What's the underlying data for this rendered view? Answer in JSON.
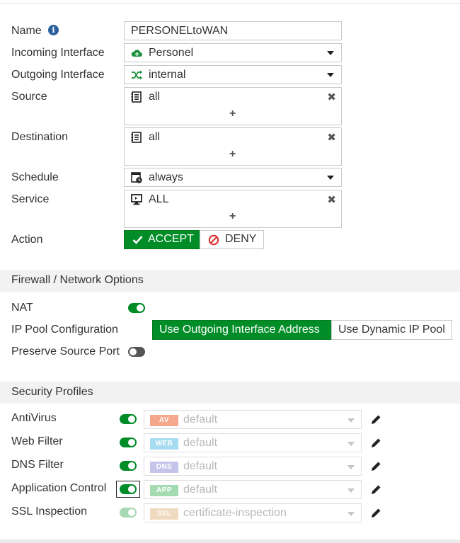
{
  "policy": {
    "name_label": "Name",
    "name_value": "PERSONELtoWAN",
    "incoming_label": "Incoming Interface",
    "incoming_value": "Personel",
    "outgoing_label": "Outgoing Interface",
    "outgoing_value": "internal",
    "source_label": "Source",
    "source_value": "all",
    "destination_label": "Destination",
    "destination_value": "all",
    "schedule_label": "Schedule",
    "schedule_value": "always",
    "service_label": "Service",
    "service_value": "ALL",
    "action_label": "Action",
    "accept_label": "ACCEPT",
    "deny_label": "DENY",
    "add_glyph": "+",
    "remove_glyph": "✖"
  },
  "firewall": {
    "section_title": "Firewall / Network Options",
    "nat_label": "NAT",
    "nat_enabled": true,
    "ippool_label": "IP Pool Configuration",
    "ippool_options": [
      "Use Outgoing Interface Address",
      "Use Dynamic IP Pool"
    ],
    "ippool_selected": "Use Outgoing Interface Address",
    "preserve_label": "Preserve Source Port",
    "preserve_enabled": false
  },
  "security": {
    "section_title": "Security Profiles",
    "profiles": [
      {
        "label": "AntiVirus",
        "badge": "AV",
        "value": "default",
        "enabled": true,
        "badge_color": "#f6a88c"
      },
      {
        "label": "Web Filter",
        "badge": "WEB",
        "value": "default",
        "enabled": true,
        "badge_color": "#a7dbef"
      },
      {
        "label": "DNS Filter",
        "badge": "DNS",
        "value": "default",
        "enabled": true,
        "badge_color": "#c5c4ea"
      },
      {
        "label": "Application Control",
        "badge": "APP",
        "value": "default",
        "enabled": true,
        "badge_color": "#a5dbb0"
      },
      {
        "label": "SSL Inspection",
        "badge": "SSL",
        "value": "certificate-inspection",
        "enabled": true,
        "badge_color": "#efd9bf"
      }
    ]
  },
  "icons": {
    "info": "info-icon",
    "personel": "cloud-icon",
    "internal": "shuffle-icon",
    "address": "address-book-icon",
    "schedule": "calendar-clock-icon",
    "service": "monitor-icon",
    "accept": "check-icon",
    "deny": "no-entry-icon",
    "edit": "pencil-icon"
  },
  "colors": {
    "accent_green": "#008c26",
    "section_bg": "#f2f2f2",
    "deny_red": "#d92d2d"
  }
}
